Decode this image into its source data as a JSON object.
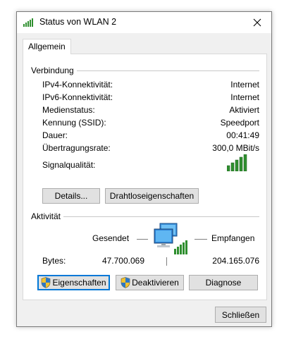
{
  "window": {
    "title": "Status von WLAN 2",
    "wifi_icon": "wifi-signal-icon",
    "close_icon": "close-icon"
  },
  "tabs": [
    {
      "label": "Allgemein",
      "selected": true
    }
  ],
  "connection": {
    "title": "Verbindung",
    "rows": [
      {
        "label": "IPv4-Konnektivität:",
        "value": "Internet"
      },
      {
        "label": "IPv6-Konnektivität:",
        "value": "Internet"
      },
      {
        "label": "Medienstatus:",
        "value": "Aktiviert"
      },
      {
        "label": "Kennung (SSID):",
        "value": "Speedport"
      },
      {
        "label": "Dauer:",
        "value": "00:41:49"
      },
      {
        "label": "Übertragungsrate:",
        "value": "300,0 MBit/s"
      }
    ],
    "signal_label": "Signalqualität:",
    "signal_bars_lit": 5,
    "signal_bars_total": 5,
    "details_button": "Details...",
    "wireless_props_button": "Drahtloseigenschaften"
  },
  "activity": {
    "title": "Aktivität",
    "sent_label": "Gesendet",
    "received_label": "Empfangen",
    "bytes_label": "Bytes:",
    "bytes_sent": "47.700.069",
    "bytes_received": "204.165.076",
    "network_icon": "network-computers-icon"
  },
  "actions": {
    "properties_button": "Eigenschaften",
    "disable_button": "Deaktivieren",
    "diagnose_button": "Diagnose",
    "shield_icon": "uac-shield-icon"
  },
  "footer": {
    "close_button": "Schließen"
  },
  "colors": {
    "accent": "#0078d7",
    "signal_green": "#2f8f2f"
  }
}
